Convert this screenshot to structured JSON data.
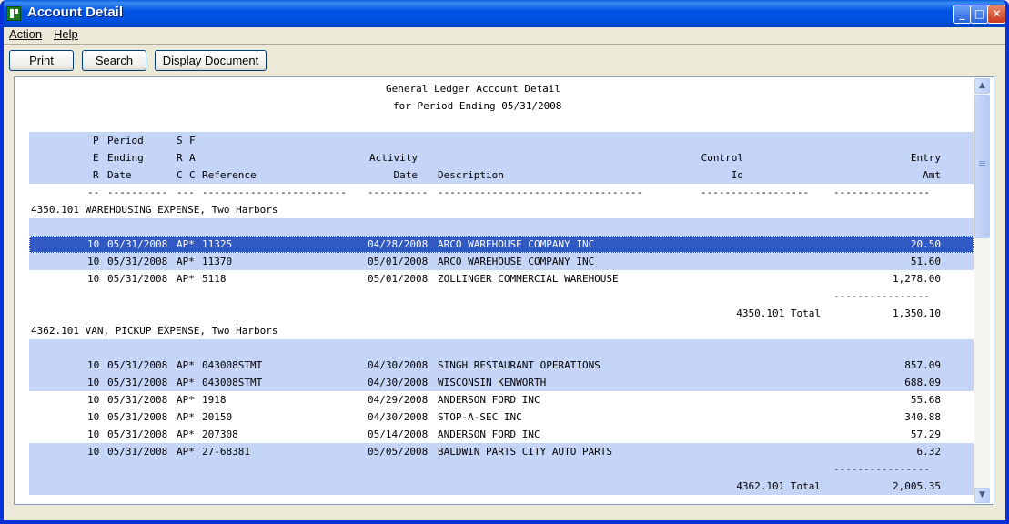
{
  "window": {
    "title": "Account Detail"
  },
  "titlebar_controls": {
    "minimize": "_",
    "maximize": "□",
    "close": "✕"
  },
  "menu": {
    "action": "Action",
    "help": "Help"
  },
  "toolbar": {
    "print": "Print",
    "search": "Search",
    "display_document": "Display Document"
  },
  "report": {
    "title": "General Ledger Account Detail",
    "subtitle": "for Period Ending 05/31/2008",
    "header_rows": [
      {
        "pe": "P",
        "period": "Period",
        "sc": "S",
        "fa": "F",
        "reference": "",
        "activity": "",
        "description": "",
        "control": "",
        "entry": ""
      },
      {
        "pe": "E",
        "period": "Ending",
        "sc": "R",
        "fa": "A",
        "reference": "",
        "activity": "Activity",
        "description": "",
        "control": "Control",
        "entry": "Entry"
      },
      {
        "pe": "R",
        "period": "Date",
        "sc": "C",
        "fa": "C",
        "reference": "Reference",
        "activity": "Date",
        "description": "Description",
        "control": "Id",
        "entry": "Amt"
      }
    ],
    "dashes": {
      "pe": "--",
      "period": "----------",
      "scfa": "---",
      "reference": "------------------------",
      "activity": "----------",
      "description": "----------------------------------",
      "control": "------------------",
      "entry": "----------------"
    },
    "accounts": [
      {
        "heading": "4350.101 WAREHOUSING EXPENSE, Two Harbors",
        "rows": [
          {
            "per": "10",
            "date": "05/31/2008",
            "src": "AP*",
            "ref": "11325",
            "act": "04/28/2008",
            "desc": "ARCO WAREHOUSE COMPANY INC",
            "amt": "20.50"
          },
          {
            "per": "10",
            "date": "05/31/2008",
            "src": "AP*",
            "ref": "11370",
            "act": "05/01/2008",
            "desc": "ARCO WAREHOUSE COMPANY INC",
            "amt": "51.60"
          },
          {
            "per": "10",
            "date": "05/31/2008",
            "src": "AP*",
            "ref": "5118",
            "act": "05/01/2008",
            "desc": "ZOLLINGER COMMERCIAL WAREHOUSE",
            "amt": "1,278.00"
          }
        ],
        "total_rule": "----------------",
        "total_label": "4350.101 Total",
        "total_amt": "1,350.10"
      },
      {
        "heading": "4362.101 VAN, PICKUP EXPENSE, Two Harbors",
        "rows": [
          {
            "per": "10",
            "date": "05/31/2008",
            "src": "AP*",
            "ref": "043008STMT",
            "act": "04/30/2008",
            "desc": "SINGH RESTAURANT OPERATIONS",
            "amt": "857.09"
          },
          {
            "per": "10",
            "date": "05/31/2008",
            "src": "AP*",
            "ref": "043008STMT",
            "act": "04/30/2008",
            "desc": "WISCONSIN KENWORTH",
            "amt": "688.09"
          },
          {
            "per": "10",
            "date": "05/31/2008",
            "src": "AP*",
            "ref": "1918",
            "act": "04/29/2008",
            "desc": "ANDERSON FORD INC",
            "amt": "55.68"
          },
          {
            "per": "10",
            "date": "05/31/2008",
            "src": "AP*",
            "ref": "20150",
            "act": "04/30/2008",
            "desc": "STOP-A-SEC INC",
            "amt": "340.88"
          },
          {
            "per": "10",
            "date": "05/31/2008",
            "src": "AP*",
            "ref": "207308",
            "act": "05/14/2008",
            "desc": "ANDERSON FORD INC",
            "amt": "57.29"
          },
          {
            "per": "10",
            "date": "05/31/2008",
            "src": "AP*",
            "ref": "27-68381",
            "act": "05/05/2008",
            "desc": "BALDWIN PARTS CITY AUTO PARTS",
            "amt": "6.32"
          }
        ],
        "total_rule": "----------------",
        "total_label": "4362.101 Total",
        "total_amt": "2,005.35"
      }
    ]
  },
  "colors": {
    "selection": "#3159C4",
    "band": "#C5D5F8",
    "title_bar": "#0055E5"
  }
}
